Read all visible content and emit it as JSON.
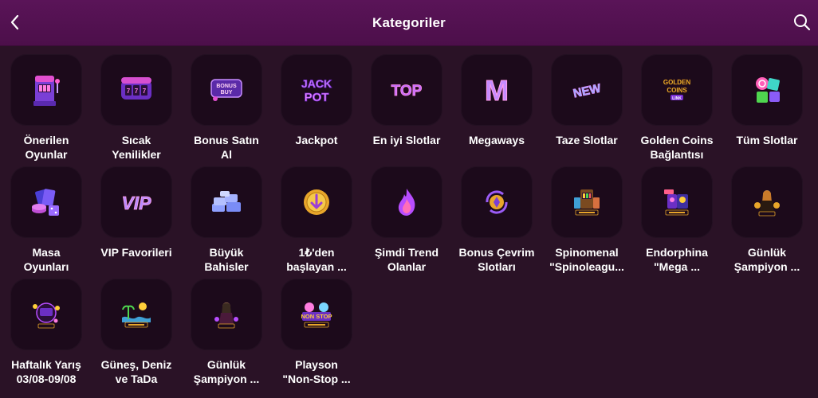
{
  "header": {
    "title": "Kategoriler",
    "back_icon": "chevron-left-icon",
    "search_icon": "search-icon"
  },
  "colors": {
    "header_bg": "#4c0f4a",
    "page_bg": "#2a1226",
    "tile_bg": "#1c0a1b",
    "accent_purple": "#b84dff",
    "accent_gold": "#e8a62a"
  },
  "categories": [
    {
      "label": "Önerilen\nOyunlar",
      "icon": "slot-machine-icon"
    },
    {
      "label": "Sıcak\nYenilikler",
      "icon": "slot-reels-icon"
    },
    {
      "label": "Bonus Satın\nAl",
      "icon": "bonus-buy-icon",
      "icon_text": "BONUS BUY"
    },
    {
      "label": "Jackpot",
      "icon": "jackpot-icon",
      "icon_text": "JACK POT"
    },
    {
      "label": "En iyi Slotlar",
      "icon": "top-icon",
      "icon_text": "TOP"
    },
    {
      "label": "Megaways",
      "icon": "megaways-icon",
      "icon_text": "M"
    },
    {
      "label": "Taze Slotlar",
      "icon": "new-icon",
      "icon_text": "NEW"
    },
    {
      "label": "Golden Coins\nBağlantısı",
      "icon": "golden-coins-icon",
      "icon_text": "GOLDEN COINS LINK"
    },
    {
      "label": "Tüm Slotlar",
      "icon": "all-slots-icon"
    },
    {
      "label": "Masa\nOyunları",
      "icon": "table-games-icon"
    },
    {
      "label": "VIP Favorileri",
      "icon": "vip-icon",
      "icon_text": "VIP"
    },
    {
      "label": "Büyük\nBahisler",
      "icon": "big-bets-icon"
    },
    {
      "label": "1₺'den\nbaşlayan ...",
      "icon": "coin-icon"
    },
    {
      "label": "Şimdi Trend\nOlanlar",
      "icon": "flame-icon"
    },
    {
      "label": "Bonus Çevrim\nSlotları",
      "icon": "wagering-coin-icon"
    },
    {
      "label": "Spinomenal\n\"Spinoleagu...",
      "icon": "tournament-slot-icon"
    },
    {
      "label": "Endorphina\n\"Mega ...",
      "icon": "tournament-slot-icon"
    },
    {
      "label": "Günlük\nŞampiyon ...",
      "icon": "champion-icon"
    },
    {
      "label": "Haftalık Yarış\n03/08-09/08",
      "icon": "race-icon"
    },
    {
      "label": "Güneş, Deniz\nve TaDa",
      "icon": "beach-icon"
    },
    {
      "label": "Günlük\nŞampiyon ...",
      "icon": "champion-icon"
    },
    {
      "label": "Playson\n\"Non-Stop ...",
      "icon": "non-stop-icon",
      "icon_text": "NON STOP"
    }
  ]
}
